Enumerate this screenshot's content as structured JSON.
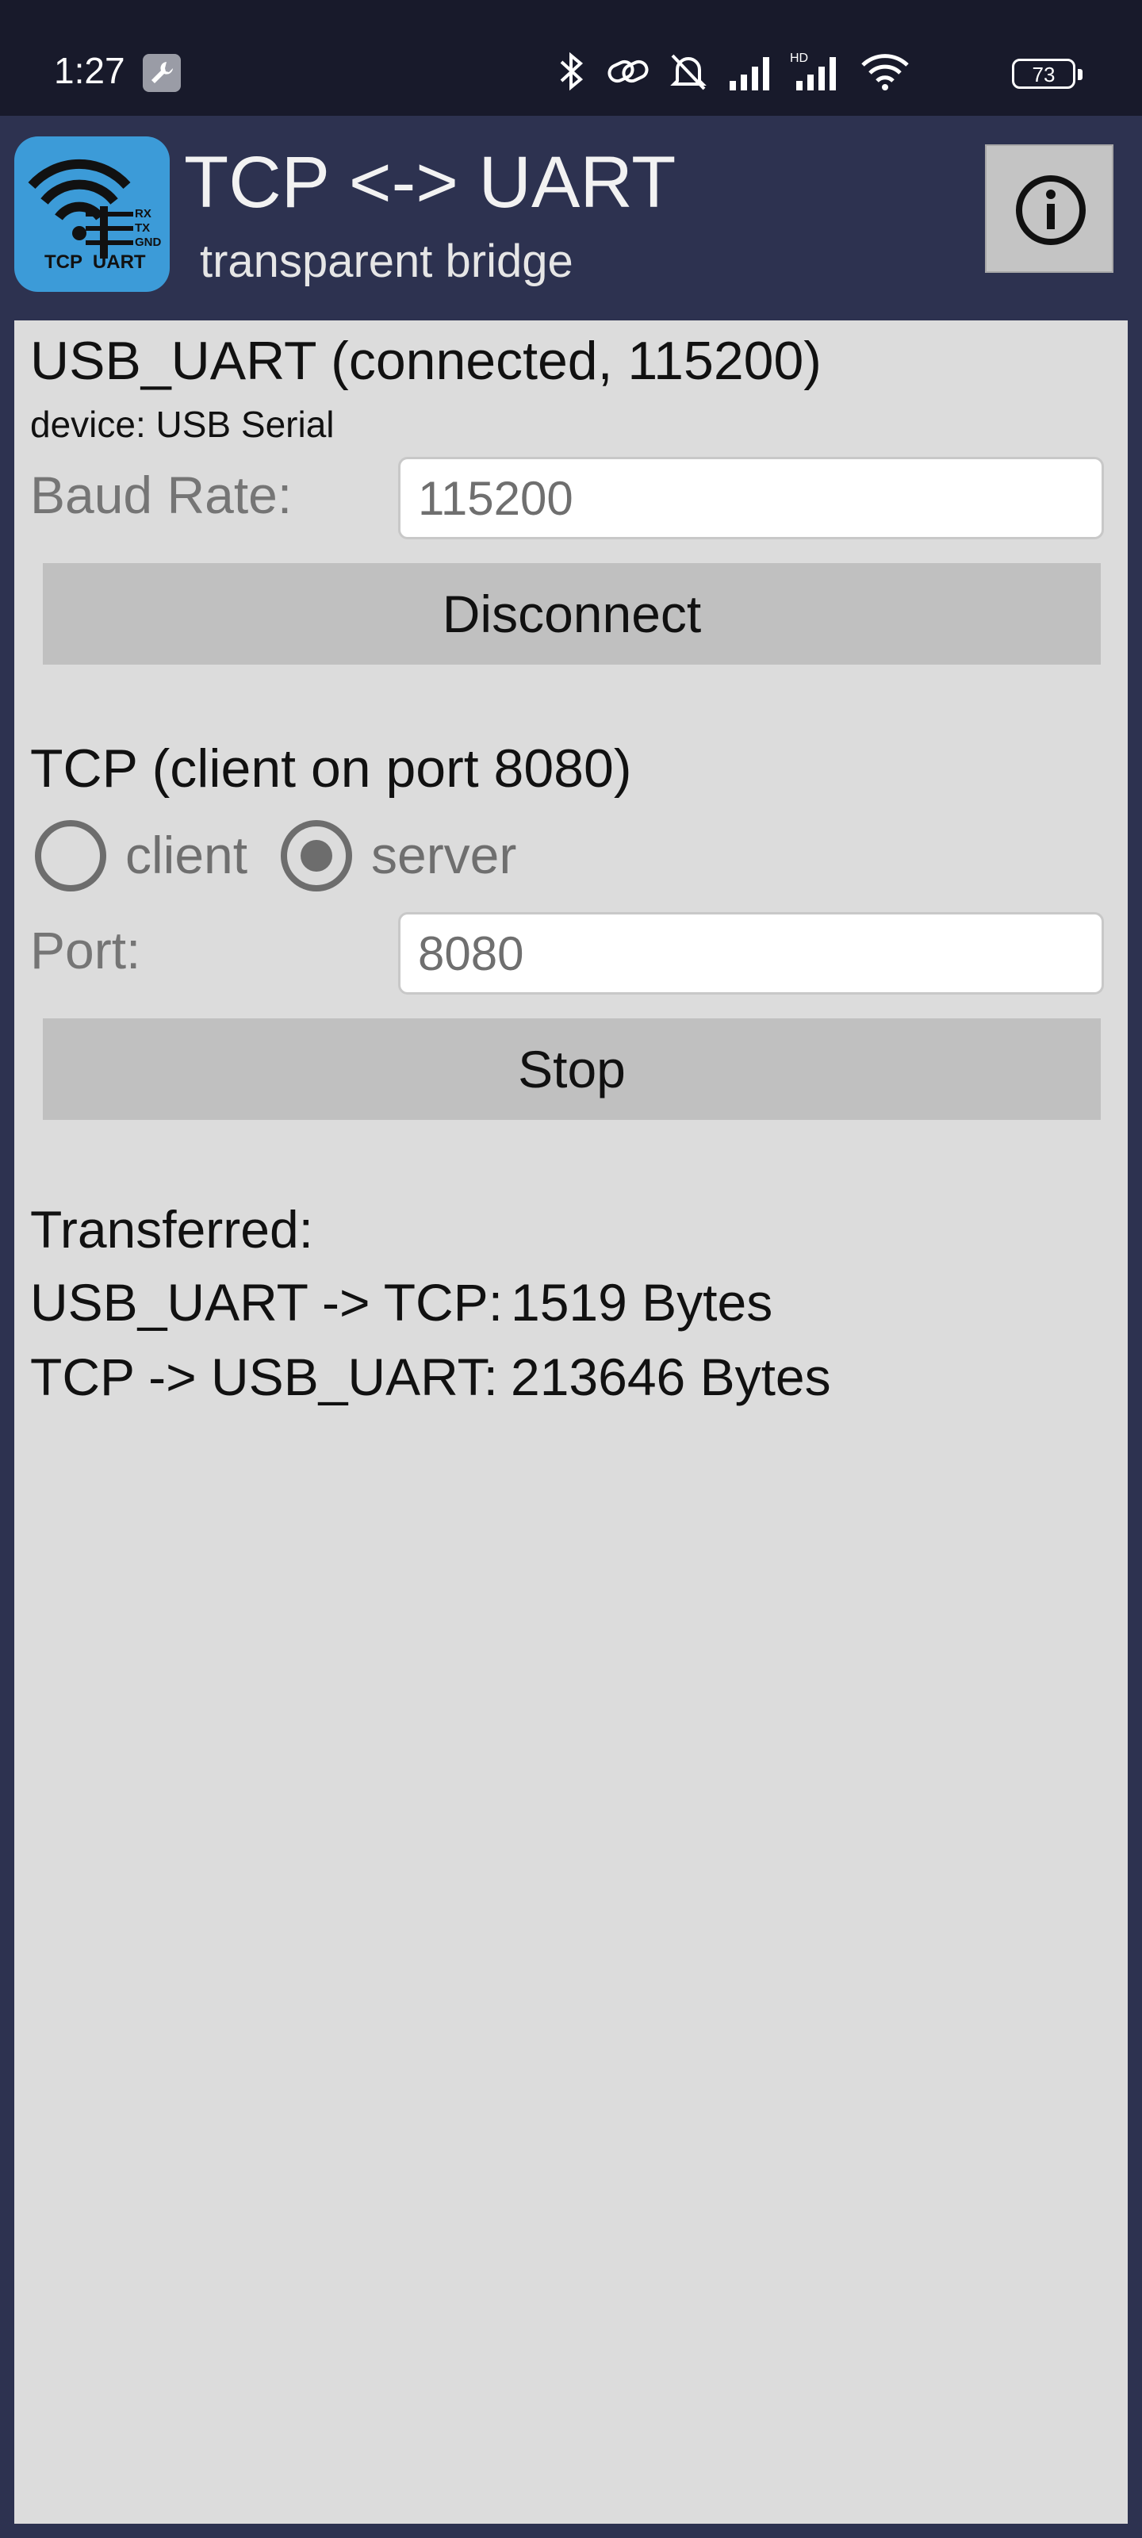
{
  "status_bar": {
    "time": "1:27",
    "battery": "73",
    "icons": [
      "wrench-icon",
      "bluetooth-icon",
      "link-icon",
      "bell-off-icon",
      "signal-icon",
      "hd-signal-icon",
      "wifi-icon",
      "battery-icon"
    ]
  },
  "header": {
    "app_icon_text": {
      "line_rx": "RX",
      "line_tx": "TX",
      "line_gnd": "GND",
      "bottom": "TCP  UART"
    },
    "title": "TCP <-> UART",
    "subtitle": "transparent bridge",
    "info_icon": "info-icon"
  },
  "uart": {
    "status": "USB_UART (connected, 115200)",
    "device": "device: USB Serial",
    "baud_label": "Baud Rate:",
    "baud_value": "115200",
    "button": "Disconnect"
  },
  "tcp": {
    "status": "TCP (client on port 8080)",
    "mode_options": [
      {
        "label": "client",
        "selected": false
      },
      {
        "label": "server",
        "selected": true
      }
    ],
    "port_label": "Port:",
    "port_value": "8080",
    "button": "Stop"
  },
  "transfer": {
    "heading": "Transferred:",
    "rows": [
      {
        "label": "USB_UART -> TCP:",
        "value": "1519 Bytes"
      },
      {
        "label": "TCP -> USB_UART:",
        "value": "213646 Bytes"
      }
    ]
  },
  "colors": {
    "header_bg": "#2d3250",
    "status_bg": "#181a2b",
    "panel_bg": "#dcdcdc",
    "button_bg": "#c0c0c0",
    "app_icon_bg": "#3c9bd8"
  }
}
